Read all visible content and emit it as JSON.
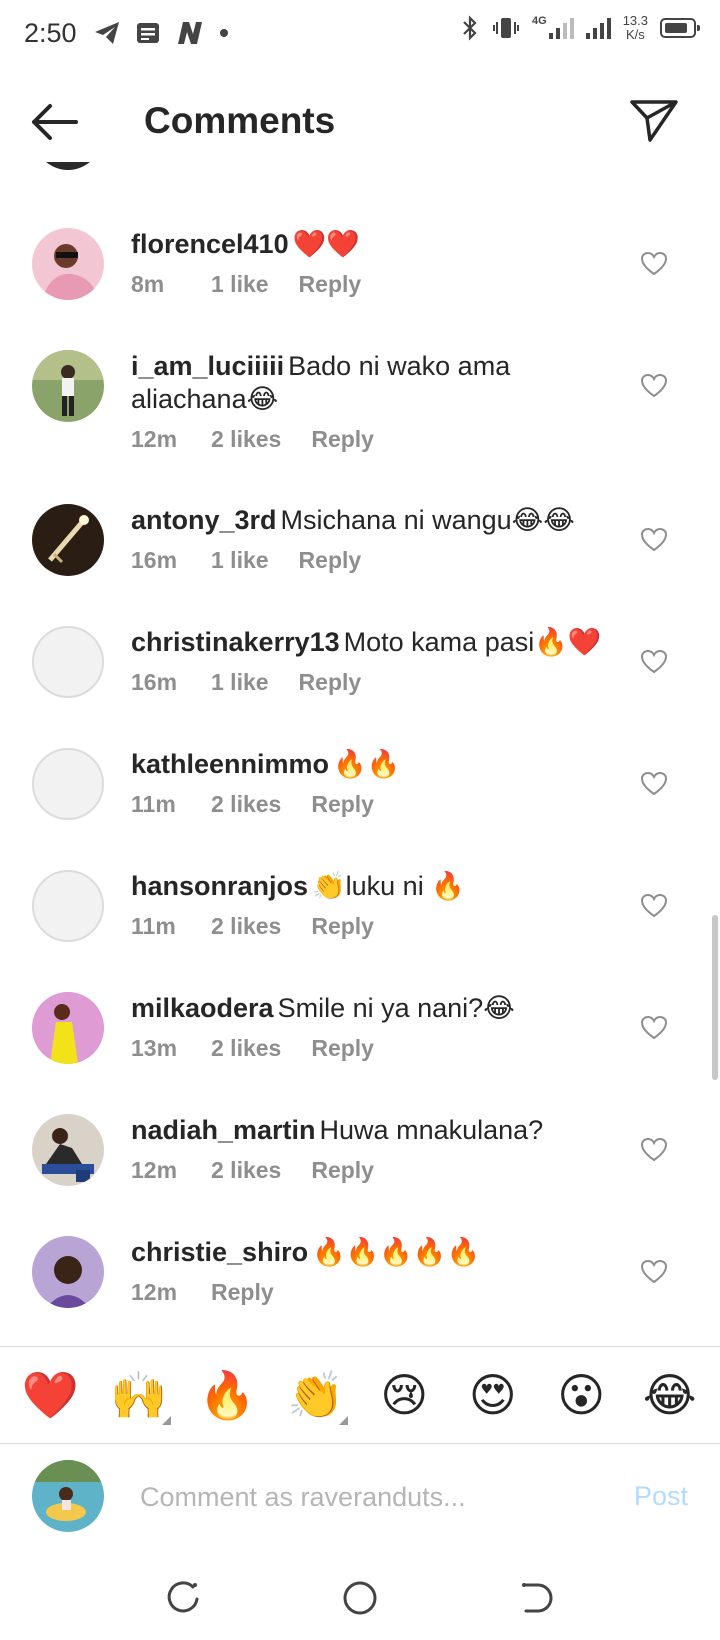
{
  "status_bar": {
    "time": "2:50",
    "network_type": "4G",
    "speed_value": "13.3",
    "speed_unit": "K/s"
  },
  "header": {
    "title": "Comments"
  },
  "comments": [
    {
      "username": "florencel410",
      "text": "❤️❤️",
      "time": "8m",
      "likes": "1 like",
      "reply": "Reply",
      "avatar": "photo-pink"
    },
    {
      "username": "i_am_luciiiii",
      "text": "Bado ni wako ama aliachana😂",
      "time": "12m",
      "likes": "2 likes",
      "reply": "Reply",
      "avatar": "photo-green"
    },
    {
      "username": "antony_3rd",
      "text": "Msichana ni wangu😂😂",
      "time": "16m",
      "likes": "1 like",
      "reply": "Reply",
      "avatar": "photo-dark"
    },
    {
      "username": "christinakerry13",
      "text": "Moto kama pasi🔥❤️",
      "time": "16m",
      "likes": "1 like",
      "reply": "Reply",
      "avatar": "placeholder"
    },
    {
      "username": "kathleennimmo",
      "text": "🔥🔥",
      "time": "11m",
      "likes": "2 likes",
      "reply": "Reply",
      "avatar": "placeholder"
    },
    {
      "username": "hansonranjos",
      "text": "👏luku ni 🔥",
      "time": "11m",
      "likes": "2 likes",
      "reply": "Reply",
      "avatar": "placeholder"
    },
    {
      "username": "milkaodera",
      "text": "Smile ni ya nani?😂",
      "time": "13m",
      "likes": "2 likes",
      "reply": "Reply",
      "avatar": "photo-yellow"
    },
    {
      "username": "nadiah_martin",
      "text": "Huwa mnakulana?",
      "time": "12m",
      "likes": "2 likes",
      "reply": "Reply",
      "avatar": "photo-blue"
    },
    {
      "username": "christie_shiro",
      "text": "🔥🔥🔥🔥🔥",
      "time": "12m",
      "likes": "",
      "reply": "Reply",
      "avatar": "photo-purple"
    }
  ],
  "emoji_bar": [
    "❤️",
    "🙌",
    "🔥",
    "👏",
    "😢",
    "😍",
    "😮",
    "😂"
  ],
  "comment_input": {
    "placeholder": "Comment as raveranduts...",
    "post_label": "Post"
  },
  "icons": {
    "back": "arrow-left-icon",
    "share": "paper-plane-icon",
    "like": "heart-outline-icon",
    "nav_recents": "recents-icon",
    "nav_home": "home-circle-icon",
    "nav_back": "back-nav-icon"
  },
  "colors": {
    "text": "#262626",
    "meta": "#8e8e8e",
    "post_disabled": "#b3dbff",
    "divider": "#dbdbdb"
  }
}
